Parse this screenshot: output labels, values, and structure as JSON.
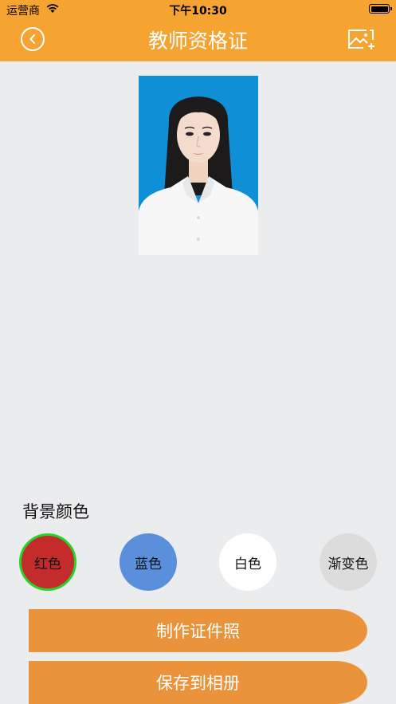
{
  "status_bar": {
    "carrier": "运营商",
    "time": "下午10:30"
  },
  "nav": {
    "title": "教师资格证"
  },
  "background_section": {
    "label": "背景颜色",
    "options": [
      {
        "label": "红色",
        "color": "#c42b2b",
        "selected": true
      },
      {
        "label": "蓝色",
        "color": "#5a8fdb",
        "selected": false
      },
      {
        "label": "白色",
        "color": "#ffffff",
        "selected": false
      },
      {
        "label": "渐变色",
        "color": "#dcdcdc",
        "selected": false
      }
    ]
  },
  "actions": {
    "make_photo": "制作证件照",
    "save_album": "保存到相册"
  },
  "colors": {
    "accent": "#f5a431",
    "button": "#eb933a",
    "photo_background": "#0e8fd6",
    "selected_ring": "#27d32a"
  }
}
